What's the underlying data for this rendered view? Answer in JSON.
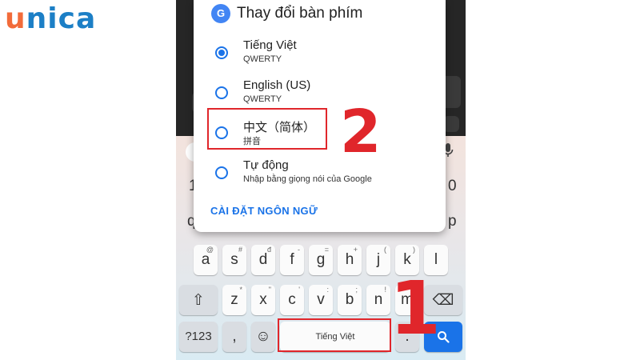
{
  "brand": {
    "logo_letters": [
      "u",
      "n",
      "i",
      "c",
      "a"
    ],
    "colors": [
      "#f26b3a",
      "#1c7fc6",
      "#1c7fc6",
      "#1c7fc6",
      "#1c7fc6"
    ]
  },
  "dialog": {
    "icon": "gboard-g-icon",
    "icon_text": "G",
    "title": "Thay đổi bàn phím",
    "options": [
      {
        "label": "Tiếng Việt",
        "sub": "QWERTY",
        "checked": true
      },
      {
        "label": "English (US)",
        "sub": "QWERTY",
        "checked": false
      },
      {
        "label": "中文（简体）",
        "sub": "拼音",
        "checked": false
      },
      {
        "label": "Tự động",
        "sub": "Nhập bằng giọng nói của Google",
        "checked": false
      }
    ],
    "settings_link": "CÀI ĐẶT NGÔN NGỮ"
  },
  "keyboard": {
    "suggestion_chevron": "‹",
    "mic_icon": "mic-icon",
    "row_numbers_visible": [
      "1",
      "0"
    ],
    "row_top_partial": [
      "q",
      "p"
    ],
    "row_home": [
      {
        "ch": "a",
        "hint": "@"
      },
      {
        "ch": "s",
        "hint": "#"
      },
      {
        "ch": "d",
        "hint": "đ"
      },
      {
        "ch": "f",
        "hint": "-"
      },
      {
        "ch": "g",
        "hint": "="
      },
      {
        "ch": "h",
        "hint": "+"
      },
      {
        "ch": "j",
        "hint": "("
      },
      {
        "ch": "k",
        "hint": ")"
      },
      {
        "ch": "l",
        "hint": ""
      }
    ],
    "row_bottom": [
      {
        "ch": "z",
        "hint": "*"
      },
      {
        "ch": "x",
        "hint": "\""
      },
      {
        "ch": "c",
        "hint": "'"
      },
      {
        "ch": "v",
        "hint": ":"
      },
      {
        "ch": "b",
        "hint": ";"
      },
      {
        "ch": "n",
        "hint": "!"
      },
      {
        "ch": "m",
        "hint": "?"
      }
    ],
    "shift_icon": "⇧",
    "backspace_icon": "⌫",
    "sym_key": "?123",
    "comma_key": ",",
    "emoji_icon": "☺",
    "space_label": "Tiếng Việt",
    "period_key": ".",
    "search_icon": "search-icon"
  },
  "annotations": {
    "marker_1": "1",
    "marker_2": "2"
  }
}
